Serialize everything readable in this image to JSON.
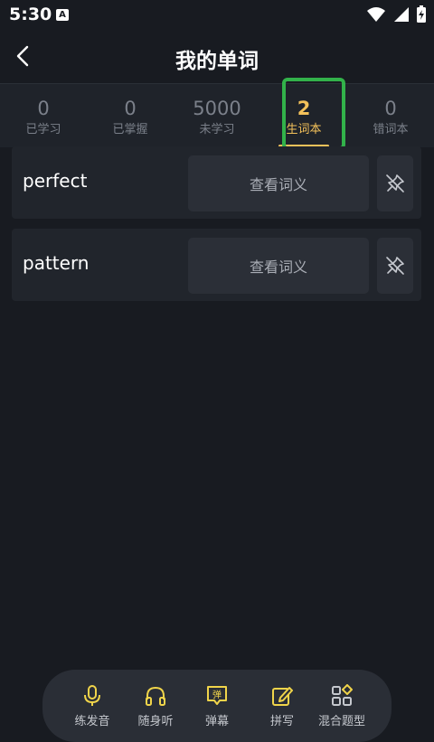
{
  "status_bar": {
    "time": "5:30",
    "notification_glyph": "A",
    "icons": [
      "wifi-icon",
      "signal-icon",
      "battery-charging-icon"
    ]
  },
  "header": {
    "title": "我的单词",
    "back_icon": "chevron-left-icon"
  },
  "tabs": [
    {
      "count": "0",
      "label": "已学习",
      "active": false
    },
    {
      "count": "0",
      "label": "已掌握",
      "active": false
    },
    {
      "count": "5000",
      "label": "未学习",
      "active": false
    },
    {
      "count": "2",
      "label": "生词本",
      "active": true
    },
    {
      "count": "0",
      "label": "错词本",
      "active": false
    }
  ],
  "words": [
    {
      "word": "perfect",
      "view_label": "查看词义",
      "pin_icon": "unpin-icon"
    },
    {
      "word": "pattern",
      "view_label": "查看词义",
      "pin_icon": "unpin-icon"
    }
  ],
  "bottom_bar": [
    {
      "label": "练发音",
      "icon": "microphone-icon"
    },
    {
      "label": "随身听",
      "icon": "headphones-icon"
    },
    {
      "label": "弹幕",
      "icon": "danmaku-icon",
      "icon_text": "弹"
    },
    {
      "label": "拼写",
      "icon": "edit-icon"
    },
    {
      "label": "混合题型",
      "icon": "grid-mixed-icon"
    }
  ],
  "colors": {
    "background": "#181b21",
    "card": "#21252c",
    "accent": "#f3c15a",
    "highlight": "#32b24a",
    "icon_yellow": "#f0d44a"
  }
}
